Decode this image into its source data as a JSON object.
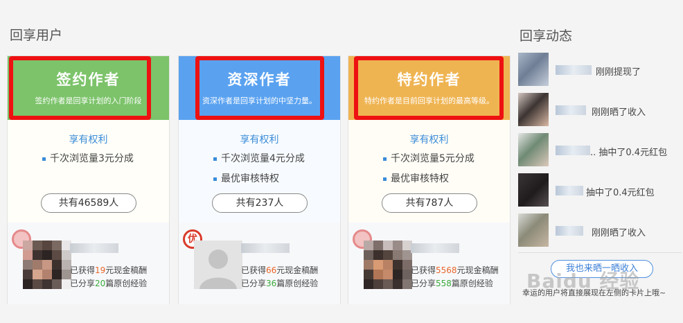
{
  "section_titles": {
    "users": "回享用户",
    "feed": "回享动态"
  },
  "cards": [
    {
      "name": "签约作者",
      "desc": "签约作者是回享计划的入门阶段",
      "rights_title": "享有权利",
      "rights": [
        "千次浏览量3元分成"
      ],
      "count": "共有46589人",
      "stat1": {
        "pre": "已获得",
        "num": "19",
        "post": "元现金稿酬"
      },
      "stat2": {
        "pre": "已分享",
        "num": "20",
        "post": "篇原创经验"
      },
      "header_color": "#7cc36a"
    },
    {
      "name": "资深作者",
      "desc": "资深作者是回享计划的中坚力量。",
      "rights_title": "享有权利",
      "rights": [
        "千次浏览量4元分成",
        "最优审核特权"
      ],
      "count": "共有237人",
      "badge": "优",
      "stat1": {
        "pre": "已获得",
        "num": "66",
        "post": "元现金稿酬"
      },
      "stat2": {
        "pre": "已分享",
        "num": "36",
        "post": "篇原创经验"
      },
      "header_color": "#5aa2f0"
    },
    {
      "name": "特约作者",
      "desc": "特约作者是目前回享计划的最高等级。",
      "rights_title": "享有权利",
      "rights": [
        "千次浏览量5元分成",
        "最优审核特权"
      ],
      "count": "共有787人",
      "stat1": {
        "pre": "已获得",
        "num": "5568",
        "post": "元现金稿酬"
      },
      "stat2": {
        "pre": "已分享",
        "num": "558",
        "post": "篇原创经验"
      },
      "header_color": "#efb452"
    }
  ],
  "feed": [
    {
      "text": "刚刚提现了"
    },
    {
      "text": "刚刚晒了收入"
    },
    {
      "text": ".. 抽中了0.4元红包"
    },
    {
      "text": "抽中了0.4元红包"
    },
    {
      "text": "刚刚晒了收入"
    }
  ],
  "share_button": "我也来晒一晒收入",
  "lucky_text": "幸运的用户将直接展现在左侧的卡片上哦~",
  "watermark": "Baidu 经验",
  "colors": {
    "highlight_box": "#ee1111",
    "link": "#3b8cd8",
    "number_orange": "#e9662a",
    "number_green": "#3aa93a"
  }
}
